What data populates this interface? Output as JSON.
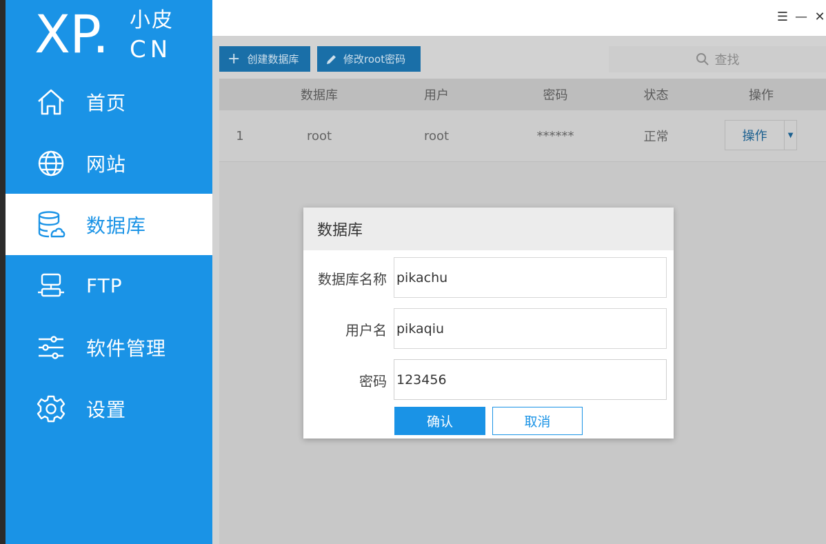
{
  "logo": {
    "mark": "XP.",
    "chinese": "小皮",
    "suffix": "CN"
  },
  "sidebar": {
    "items": [
      {
        "label": "首页",
        "icon": "home-icon",
        "active": false
      },
      {
        "label": "网站",
        "icon": "globe-icon",
        "active": false
      },
      {
        "label": "数据库",
        "icon": "database-icon",
        "active": true
      },
      {
        "label": "FTP",
        "icon": "ftp-server-icon",
        "active": false
      },
      {
        "label": "软件管理",
        "icon": "sliders-icon",
        "active": false
      },
      {
        "label": "设置",
        "icon": "gear-icon",
        "active": false
      }
    ]
  },
  "window": {
    "menu_icon": "☰",
    "minimize_icon": "—",
    "close_icon": "✕"
  },
  "toolbar": {
    "create_label": "创建数据库",
    "change_pw_label": "修改root密码",
    "search_placeholder": "查找"
  },
  "table": {
    "columns": [
      "",
      "数据库",
      "用户",
      "密码",
      "状态",
      "操作"
    ],
    "rows": [
      {
        "index": "1",
        "database": "root",
        "user": "root",
        "password": "******",
        "status": "正常",
        "action": "操作"
      }
    ]
  },
  "modal": {
    "title": "数据库",
    "fields": [
      {
        "label": "数据库名称",
        "value": "pikachu"
      },
      {
        "label": "用户名",
        "value": "pikaqiu"
      },
      {
        "label": "密码",
        "value": "123456"
      }
    ],
    "confirm_label": "确认",
    "cancel_label": "取消"
  },
  "colors": {
    "accent": "#1a93e6",
    "overlay_bg": "#d2d2d2"
  }
}
